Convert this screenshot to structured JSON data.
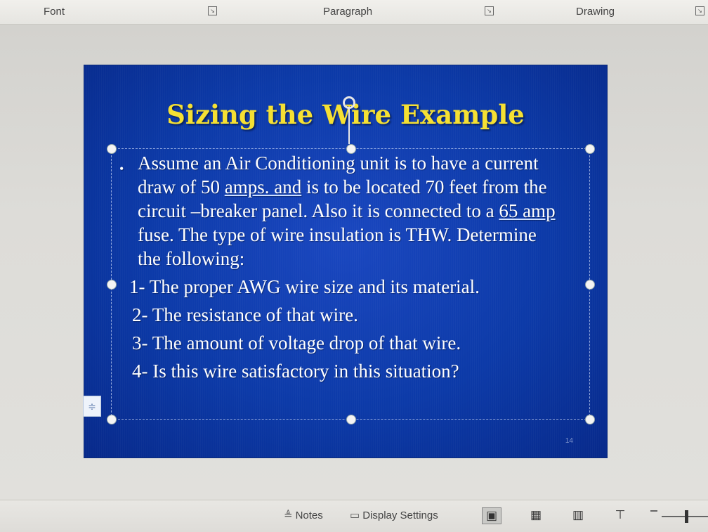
{
  "ribbon": {
    "groups": [
      {
        "label": "Font"
      },
      {
        "label": "Paragraph"
      },
      {
        "label": "Drawing"
      }
    ]
  },
  "slide": {
    "title": "Sizing the Wire Example",
    "bullet": {
      "part1": "Assume an Air Conditioning unit is to have a current draw of 50 ",
      "underlined1": "amps. and",
      "part2": " is to be located 70 feet from the circuit –breaker panel. Also it is connected to a ",
      "underlined2": "65 amp",
      "part3": " fuse. The type of wire insulation is THW. Determine the following:"
    },
    "items": [
      "1- The proper AWG wire size and its material.",
      "2- The resistance of that wire.",
      "3- The amount of voltage drop of that wire.",
      "4- Is this wire satisfactory in this situation?"
    ],
    "slide_number": "14"
  },
  "statusbar": {
    "notes_label": "Notes",
    "display_settings_label": "Display Settings"
  },
  "icons": {
    "notes": "notes-icon",
    "display_settings": "display-settings-icon",
    "normal_view": "normal-view-icon",
    "slide_sorter": "slide-sorter-icon",
    "reading_view": "reading-view-icon",
    "slide_show": "slide-show-icon",
    "layout_options": "layout-options-icon"
  },
  "colors": {
    "slide_background": "#0c3aa8",
    "title": "#f5e033",
    "body_text": "#ffffff"
  }
}
